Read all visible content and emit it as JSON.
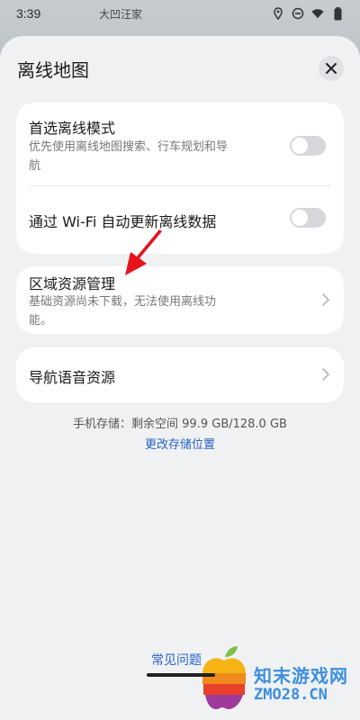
{
  "status_bar": {
    "time": "3:39",
    "map_place": "大凹汪家"
  },
  "sheet": {
    "title": "离线地图"
  },
  "card1": {
    "row1": {
      "title": "首选离线模式",
      "subtitle_line1": "优先使用离线地图搜索、行车规划和导",
      "subtitle_line2": "航",
      "toggle_on": false
    },
    "row2": {
      "title": "通过 Wi-Fi 自动更新离线数据",
      "toggle_on": false
    }
  },
  "card2": {
    "title": "区域资源管理",
    "subtitle_line1": "基础资源尚未下载，无法使用离线功",
    "subtitle_line2": "能。"
  },
  "card3": {
    "title": "导航语音资源"
  },
  "storage": {
    "info": "手机存储：剩余空间 99.9 GB/128.0 GB",
    "change_link": "更改存储位置"
  },
  "footer": {
    "faq": "常见问题"
  },
  "watermark": {
    "name_cn": "知末游戏网",
    "name_en": "ZMO28.CN"
  },
  "colors": {
    "accent": "#2762c9",
    "arrow": "#e8121a",
    "watermark": "#3b8fe0"
  }
}
